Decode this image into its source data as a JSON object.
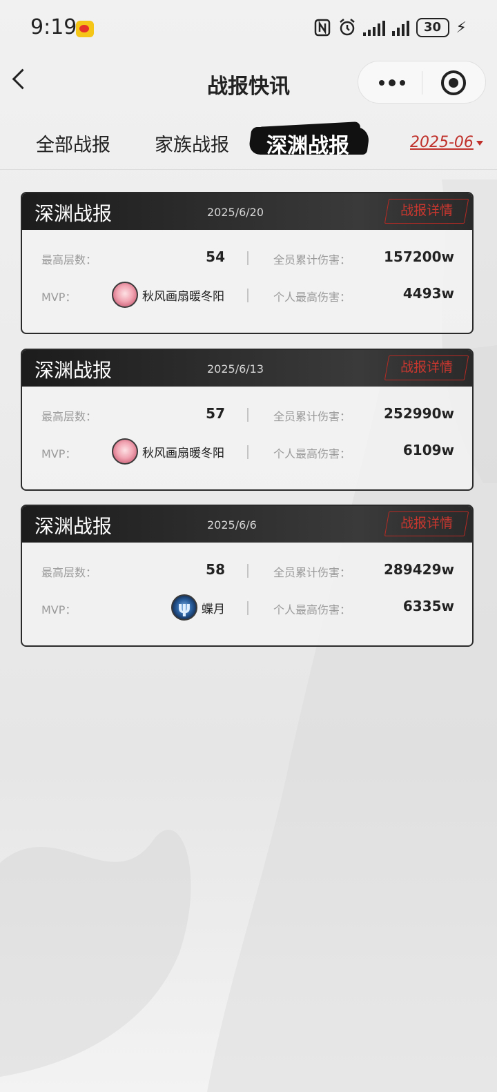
{
  "status_bar": {
    "time": "9:19",
    "battery": "30"
  },
  "nav": {
    "title": "战报快讯"
  },
  "tabs": [
    {
      "label": "全部战报"
    },
    {
      "label": "家族战报"
    },
    {
      "label": "深渊战报"
    }
  ],
  "month_filter": "2025-06",
  "labels": {
    "max_floor": "最高层数：",
    "total_damage": "全员累计伤害：",
    "mvp": "MVP：",
    "personal_max_damage": "个人最高伤害：",
    "detail_button": "战报详情"
  },
  "reports": [
    {
      "title": "深渊战报",
      "date": "2025/6/20",
      "max_floor": "54",
      "total_damage": "157200w",
      "mvp_name": "秋风画扇暖冬阳",
      "personal_max_damage": "4493w"
    },
    {
      "title": "深渊战报",
      "date": "2025/6/13",
      "max_floor": "57",
      "total_damage": "252990w",
      "mvp_name": "秋风画扇暖冬阳",
      "personal_max_damage": "6109w"
    },
    {
      "title": "深渊战报",
      "date": "2025/6/6",
      "max_floor": "58",
      "total_damage": "289429w",
      "mvp_name": "蝶月",
      "personal_max_damage": "6335w"
    }
  ]
}
